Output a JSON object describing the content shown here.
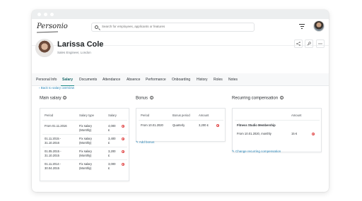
{
  "app": {
    "logo_text": "Personio",
    "search_placeholder": "Search for employees, applicants or features"
  },
  "profile": {
    "name": "Larissa Cole",
    "subtitle": "Sales Engineer, London"
  },
  "tabs": [
    {
      "label": "Personal Info"
    },
    {
      "label": "Salary",
      "active": true
    },
    {
      "label": "Documents"
    },
    {
      "label": "Attendance"
    },
    {
      "label": "Absence"
    },
    {
      "label": "Performance"
    },
    {
      "label": "Onboarding"
    },
    {
      "label": "History"
    },
    {
      "label": "Roles"
    },
    {
      "label": "Notes"
    }
  ],
  "back_link": "Back to salary overview",
  "main_salary": {
    "title": "Main salary",
    "columns": [
      "Period",
      "Salary type",
      "Salary"
    ],
    "rows": [
      {
        "period": [
          "From 01.11.2016"
        ],
        "type": [
          "Fix salary",
          "(Monthly)"
        ],
        "salary": [
          "4,000",
          "£"
        ]
      },
      {
        "period": [
          "01.11.2015 -",
          "31.10.2016"
        ],
        "type": [
          "Fix salary",
          "(Monthly)"
        ],
        "salary": [
          "3,400",
          "£"
        ]
      },
      {
        "period": [
          "01.05.2015 -",
          "31.10.2015"
        ],
        "type": [
          "Fix salary",
          "(Monthly)"
        ],
        "salary": [
          "3,200",
          "£"
        ]
      },
      {
        "period": [
          "01.11.2014 -",
          "30.04.2015"
        ],
        "type": [
          "Fix salary",
          "(Monthly)"
        ],
        "salary": [
          "3,000",
          "£"
        ]
      }
    ]
  },
  "bonus": {
    "title": "Bonus",
    "columns": [
      "Period",
      "Bonus period",
      "Amount"
    ],
    "rows": [
      {
        "period": "From 10.01.2020",
        "bonus_period": "Quarterly",
        "amount": "3,200 £"
      }
    ],
    "add_link": "Add bonus"
  },
  "recurring": {
    "title": "Recurring compensation",
    "columns": [
      "",
      "Amount"
    ],
    "item_name": "Fitness Studio Membership",
    "rows": [
      {
        "period": "From 10.01.2020, monthly",
        "amount": "15 €"
      }
    ],
    "change_link": "Change recurring compensation"
  },
  "colors": {
    "accent": "#1b8a86",
    "link": "#2a86b8",
    "remove": "#e04545"
  },
  "icons": [
    "search-icon",
    "filter-icon",
    "share-icon",
    "key-icon",
    "more-icon",
    "info-icon",
    "remove-icon",
    "pencil-icon",
    "back-arrow-icon"
  ]
}
